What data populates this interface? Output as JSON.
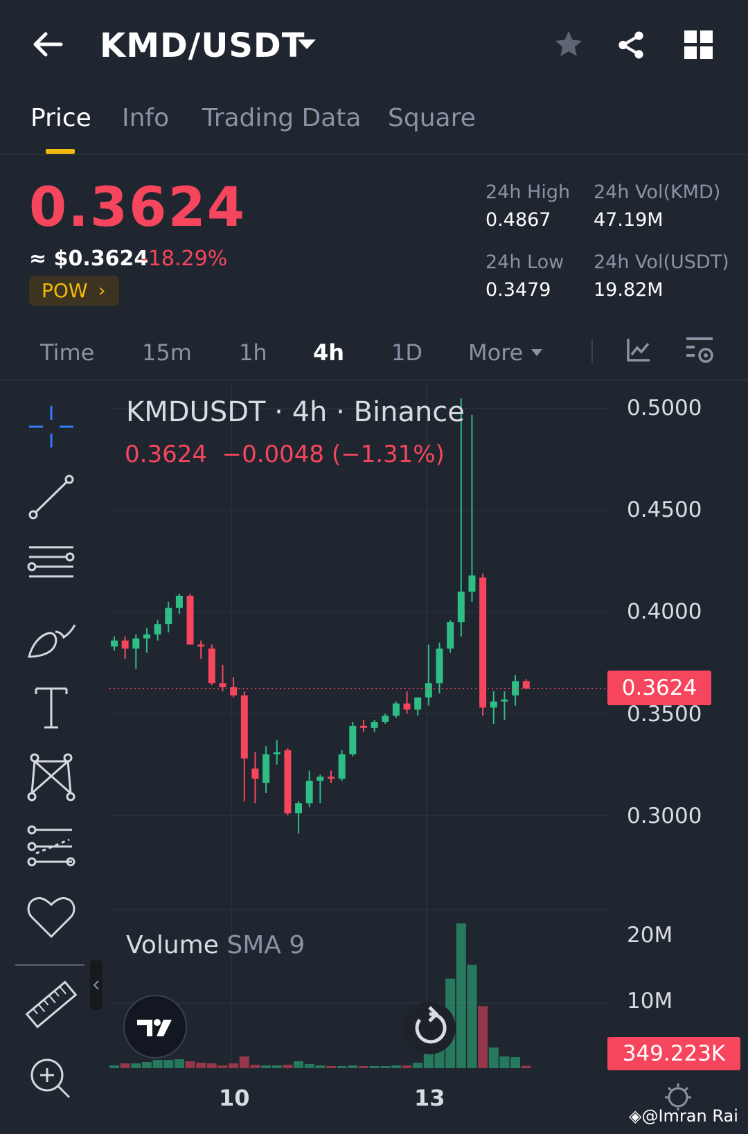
{
  "header": {
    "title": "KMD/USDT",
    "back_icon": "arrow-left-icon",
    "icons": [
      "star-icon",
      "share-icon",
      "grid-icon"
    ]
  },
  "tabs": [
    {
      "label": "Price",
      "active": true
    },
    {
      "label": "Info",
      "active": false
    },
    {
      "label": "Trading Data",
      "active": false
    },
    {
      "label": "Square",
      "active": false
    }
  ],
  "ticker": {
    "last_price": "0.3624",
    "usd_price": "≈ $0.3624",
    "change_pct": "-18.29%",
    "tag": "POW",
    "stats": {
      "high_label": "24h High",
      "high_value": "0.4867",
      "vol_kmd_label": "24h Vol(KMD)",
      "vol_kmd_value": "47.19M",
      "low_label": "24h Low",
      "low_value": "0.3479",
      "vol_usdt_label": "24h Vol(USDT)",
      "vol_usdt_value": "19.82M"
    }
  },
  "timeframes": [
    {
      "label": "Time",
      "active": false
    },
    {
      "label": "15m",
      "active": false
    },
    {
      "label": "1h",
      "active": false
    },
    {
      "label": "4h",
      "active": true
    },
    {
      "label": "1D",
      "active": false
    },
    {
      "label": "More",
      "active": false
    }
  ],
  "chart_header": {
    "title": "KMDUSDT · 4h · Binance",
    "ohlc": "0.3624  −0.0048 (−1.31%)"
  },
  "price_axis": [
    "0.5000",
    "0.4500",
    "0.4000",
    "0.3500",
    "0.3000"
  ],
  "current_price_tag": "0.3624",
  "volume_header": {
    "label": "Volume",
    "sma": "SMA 9"
  },
  "volume_axis": [
    "20M",
    "10M"
  ],
  "current_volume_tag": "349.223K",
  "x_labels": [
    "10",
    "13"
  ],
  "watermark": "@Imran Rai",
  "colors": {
    "up": "#2ebd85",
    "down": "#f6465d",
    "accent": "#f0b90b",
    "bg": "#202630"
  },
  "chart_data": {
    "type": "candlestick",
    "price_range": [
      0.28,
      0.51
    ],
    "volume_range": [
      0,
      22000000
    ],
    "candles": [
      {
        "o": 0.383,
        "h": 0.388,
        "l": 0.381,
        "c": 0.386,
        "v": 400000
      },
      {
        "o": 0.386,
        "h": 0.388,
        "l": 0.377,
        "c": 0.382,
        "v": 700000
      },
      {
        "o": 0.382,
        "h": 0.389,
        "l": 0.372,
        "c": 0.387,
        "v": 700000
      },
      {
        "o": 0.387,
        "h": 0.392,
        "l": 0.38,
        "c": 0.389,
        "v": 900000
      },
      {
        "o": 0.389,
        "h": 0.396,
        "l": 0.386,
        "c": 0.394,
        "v": 1200000
      },
      {
        "o": 0.394,
        "h": 0.405,
        "l": 0.39,
        "c": 0.402,
        "v": 1200000
      },
      {
        "o": 0.402,
        "h": 0.409,
        "l": 0.399,
        "c": 0.408,
        "v": 1300000
      },
      {
        "o": 0.408,
        "h": 0.409,
        "l": 0.388,
        "c": 0.384,
        "v": 1000000
      },
      {
        "o": 0.384,
        "h": 0.386,
        "l": 0.377,
        "c": 0.383,
        "v": 800000
      },
      {
        "o": 0.382,
        "h": 0.384,
        "l": 0.364,
        "c": 0.365,
        "v": 700000
      },
      {
        "o": 0.365,
        "h": 0.374,
        "l": 0.361,
        "c": 0.363,
        "v": 400000
      },
      {
        "o": 0.363,
        "h": 0.368,
        "l": 0.358,
        "c": 0.359,
        "v": 700000
      },
      {
        "o": 0.359,
        "h": 0.361,
        "l": 0.307,
        "c": 0.328,
        "v": 1700000
      },
      {
        "o": 0.323,
        "h": 0.331,
        "l": 0.306,
        "c": 0.318,
        "v": 500000
      },
      {
        "o": 0.316,
        "h": 0.334,
        "l": 0.311,
        "c": 0.33,
        "v": 400000
      },
      {
        "o": 0.33,
        "h": 0.337,
        "l": 0.325,
        "c": 0.331,
        "v": 400000
      },
      {
        "o": 0.332,
        "h": 0.333,
        "l": 0.3,
        "c": 0.301,
        "v": 500000
      },
      {
        "o": 0.301,
        "h": 0.307,
        "l": 0.291,
        "c": 0.306,
        "v": 1000000
      },
      {
        "o": 0.306,
        "h": 0.322,
        "l": 0.304,
        "c": 0.317,
        "v": 600000
      },
      {
        "o": 0.317,
        "h": 0.32,
        "l": 0.306,
        "c": 0.319,
        "v": 400000
      },
      {
        "o": 0.319,
        "h": 0.322,
        "l": 0.316,
        "c": 0.318,
        "v": 300000
      },
      {
        "o": 0.318,
        "h": 0.332,
        "l": 0.317,
        "c": 0.33,
        "v": 300000
      },
      {
        "o": 0.33,
        "h": 0.346,
        "l": 0.329,
        "c": 0.344,
        "v": 400000
      },
      {
        "o": 0.344,
        "h": 0.347,
        "l": 0.341,
        "c": 0.343,
        "v": 300000
      },
      {
        "o": 0.343,
        "h": 0.347,
        "l": 0.341,
        "c": 0.346,
        "v": 300000
      },
      {
        "o": 0.346,
        "h": 0.35,
        "l": 0.345,
        "c": 0.349,
        "v": 300000
      },
      {
        "o": 0.349,
        "h": 0.356,
        "l": 0.348,
        "c": 0.355,
        "v": 400000
      },
      {
        "o": 0.355,
        "h": 0.361,
        "l": 0.35,
        "c": 0.352,
        "v": 400000
      },
      {
        "o": 0.352,
        "h": 0.358,
        "l": 0.349,
        "c": 0.358,
        "v": 800000
      },
      {
        "o": 0.358,
        "h": 0.384,
        "l": 0.354,
        "c": 0.365,
        "v": 2500000
      },
      {
        "o": 0.365,
        "h": 0.385,
        "l": 0.36,
        "c": 0.382,
        "v": 5000000
      },
      {
        "o": 0.382,
        "h": 0.396,
        "l": 0.38,
        "c": 0.395,
        "v": 13000000
      },
      {
        "o": 0.395,
        "h": 0.505,
        "l": 0.388,
        "c": 0.41,
        "v": 21000000
      },
      {
        "o": 0.41,
        "h": 0.497,
        "l": 0.405,
        "c": 0.418,
        "v": 15000000
      },
      {
        "o": 0.417,
        "h": 0.419,
        "l": 0.349,
        "c": 0.353,
        "v": 9000000
      },
      {
        "o": 0.353,
        "h": 0.361,
        "l": 0.345,
        "c": 0.356,
        "v": 3000000
      },
      {
        "o": 0.356,
        "h": 0.361,
        "l": 0.347,
        "c": 0.357,
        "v": 1700000
      },
      {
        "o": 0.359,
        "h": 0.369,
        "l": 0.354,
        "c": 0.366,
        "v": 1600000
      },
      {
        "o": 0.366,
        "h": 0.367,
        "l": 0.362,
        "c": 0.3624,
        "v": 349223
      }
    ]
  }
}
